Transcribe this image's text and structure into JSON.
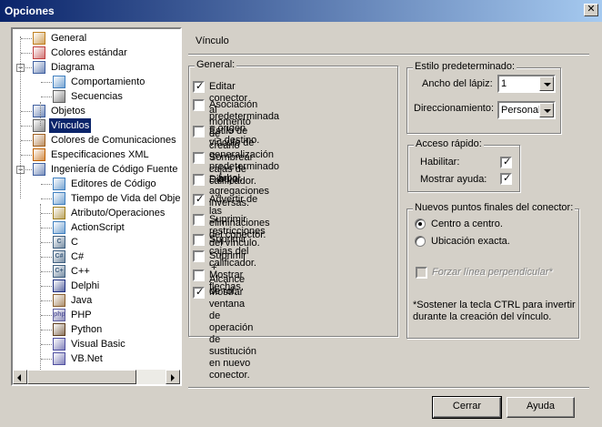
{
  "window": {
    "title": "Opciones",
    "close_glyph": "✕"
  },
  "tree": {
    "items": [
      {
        "label": "General",
        "icon": "general-icon",
        "color": "#c08020"
      },
      {
        "label": "Colores estándar",
        "icon": "palette-icon",
        "color": "#c04040"
      },
      {
        "label": "Diagrama",
        "icon": "folder-icon",
        "color": "#4060a0",
        "expander": "−"
      },
      {
        "label": "Comportamiento",
        "icon": "document-icon",
        "color": "#4080c0"
      },
      {
        "label": "Secuencias",
        "icon": "sequence-icon",
        "color": "#606060"
      },
      {
        "label": "Objetos",
        "icon": "objects-icon",
        "color": "#4060a0"
      },
      {
        "label": "Vínculos",
        "icon": "links-icon",
        "color": "#606060"
      },
      {
        "label": "Colores de Comunicaciones",
        "icon": "communications-icon",
        "color": "#a06020"
      },
      {
        "label": "Especificaciones XML",
        "icon": "xml-icon",
        "color": "#c06000"
      },
      {
        "label": "Ingeniería de Código Fuente",
        "icon": "code-engineering-icon",
        "color": "#4060a0",
        "expander": "−"
      },
      {
        "label": "Editores de Código",
        "icon": "code-editor-icon",
        "color": "#4080c0"
      },
      {
        "label": "Tiempo de Vida del Objeto",
        "icon": "object-lifetime-icon",
        "color": "#4080c0"
      },
      {
        "label": "Atributo/Operaciones",
        "icon": "attribute-icon",
        "color": "#a08020"
      },
      {
        "label": "ActionScript",
        "icon": "actionscript-icon",
        "color": "#4080c0"
      },
      {
        "label": "C",
        "icon": "c-language-icon",
        "color": "#406080",
        "glyph": "C"
      },
      {
        "label": "C#",
        "icon": "csharp-icon",
        "color": "#406080",
        "glyph": "C#"
      },
      {
        "label": "C++",
        "icon": "cpp-icon",
        "color": "#406080",
        "glyph": "C+"
      },
      {
        "label": "Delphi",
        "icon": "delphi-icon",
        "color": "#203080"
      },
      {
        "label": "Java",
        "icon": "java-icon",
        "color": "#8a6030"
      },
      {
        "label": "PHP",
        "icon": "php-icon",
        "color": "#6060a0",
        "glyph": "php"
      },
      {
        "label": "Python",
        "icon": "python-icon",
        "color": "#604020"
      },
      {
        "label": "Visual Basic",
        "icon": "visual-basic-icon",
        "color": "#5050a0"
      },
      {
        "label": "VB.Net",
        "icon": "vbnet-icon",
        "color": "#5050a0"
      }
    ],
    "selected_index": 6
  },
  "page": {
    "title": "Vínculo"
  },
  "general": {
    "legend": "General:",
    "options": [
      {
        "label": "Editar conector al momento de crearlo",
        "checked": true
      },
      {
        "label": "Asociación predeterminada = origen\n--> destino.",
        "checked": false
      },
      {
        "label": "Estilo de vinculo de generalización\npredeterminado  = árbol.",
        "checked": false
      },
      {
        "label": "Sombrear cajas de calificador.",
        "checked": false
      },
      {
        "label": "Dibujar agregaciones inversas.",
        "checked": false
      },
      {
        "label": "Advertir de las eliminaciones del conector.",
        "checked": true
      },
      {
        "label": "Suprimir restricciones del vínculo.",
        "checked": false
      },
      {
        "label": "Suprimir cajas del calificador.",
        "checked": false
      },
      {
        "label": "Suprimir '+' Alcance de rol.",
        "checked": false
      },
      {
        "label": "Mostrar flechas.",
        "checked": false
      },
      {
        "label": "Mostrar ventana de operación de\nsustitución en nuevo conector.",
        "checked": true
      }
    ],
    "check_glyph": "✓"
  },
  "style": {
    "legend": "Estilo predeterminado:",
    "pen_width_label": "Ancho del lápiz:",
    "pen_width_value": "1",
    "routing_label": "Direccionamiento:",
    "routing_value": "Personali"
  },
  "quick_access": {
    "legend": "Acceso rápido:",
    "enable_label": "Habilitar:",
    "enable_checked": true,
    "show_help_label": "Mostrar ayuda:",
    "show_help_checked": true
  },
  "endpoints": {
    "legend": "Nuevos puntos finales del conector:",
    "options": [
      {
        "label": "Centro a centro.",
        "selected": true
      },
      {
        "label": "Ubicación exacta.",
        "selected": false
      }
    ],
    "force_perpendicular": "Forzar línea perpendicular*",
    "note": "*Sostener la tecla CTRL para invertir\ndurante la creación del vínculo."
  },
  "buttons": {
    "close": "Cerrar",
    "help": "Ayuda"
  }
}
